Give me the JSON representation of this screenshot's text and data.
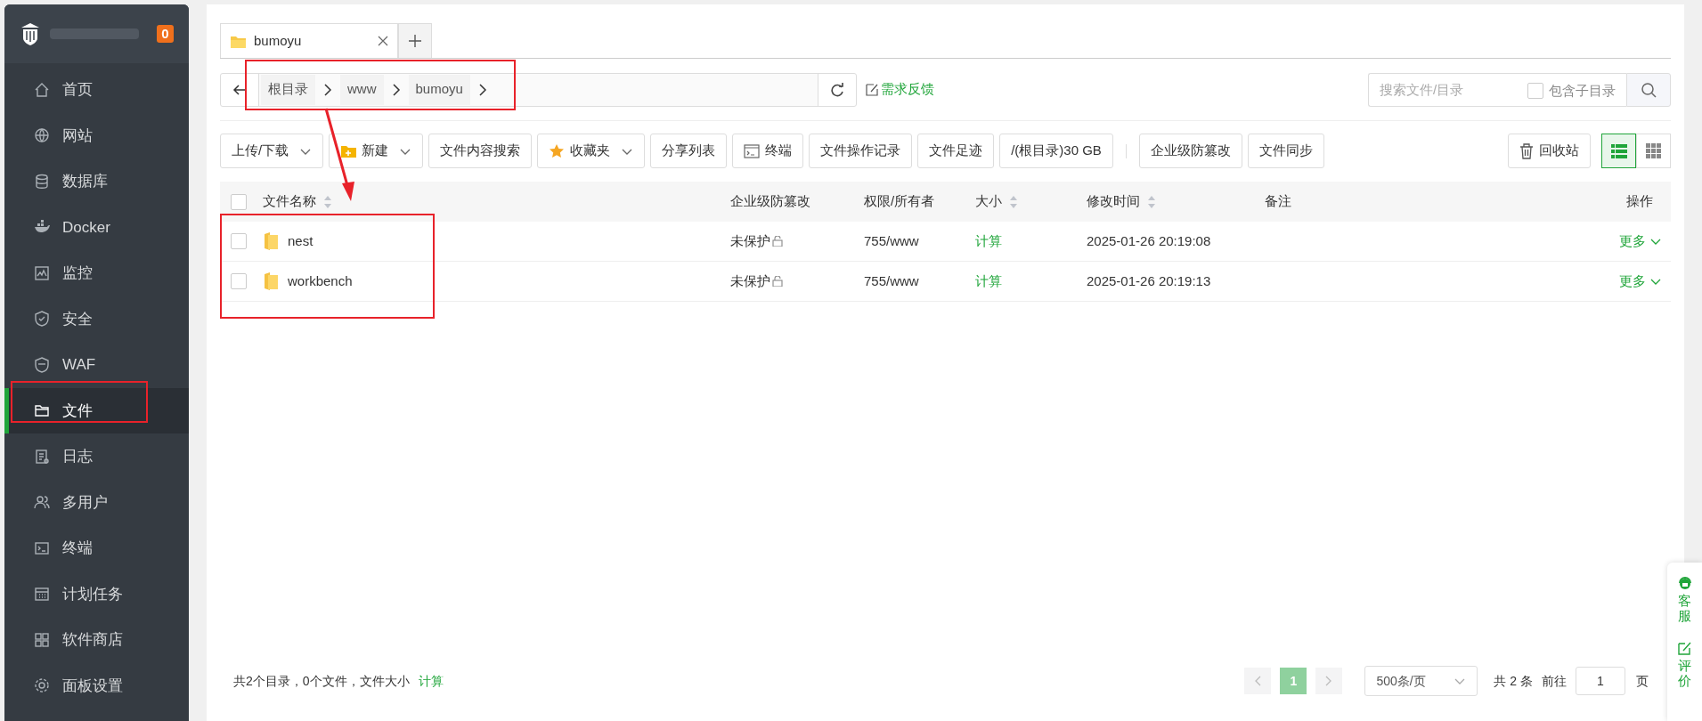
{
  "sidebar": {
    "badge": "0",
    "items": [
      {
        "label": "首页",
        "selected": false
      },
      {
        "label": "网站",
        "selected": false
      },
      {
        "label": "数据库",
        "selected": false
      },
      {
        "label": "Docker",
        "selected": false
      },
      {
        "label": "监控",
        "selected": false
      },
      {
        "label": "安全",
        "selected": false
      },
      {
        "label": "WAF",
        "selected": false
      },
      {
        "label": "文件",
        "selected": true
      },
      {
        "label": "日志",
        "selected": false
      },
      {
        "label": "多用户",
        "selected": false
      },
      {
        "label": "终端",
        "selected": false
      },
      {
        "label": "计划任务",
        "selected": false
      },
      {
        "label": "软件商店",
        "selected": false
      },
      {
        "label": "面板设置",
        "selected": false
      }
    ]
  },
  "tabs": [
    {
      "label": "bumoyu",
      "selected": true
    }
  ],
  "path_bar": {
    "crumbs": [
      "根目录",
      "www",
      "bumoyu"
    ],
    "feedback_link": "需求反馈"
  },
  "search": {
    "placeholder": "搜索文件/目录",
    "include_subdirs": {
      "label": "包含子目录",
      "checked": false
    }
  },
  "toolbar": {
    "groups": [
      [
        {
          "label": "上传/下载",
          "dropdown": true
        },
        {
          "label": "新建",
          "dropdown": true
        },
        {
          "label": "文件内容搜索",
          "dropdown": false
        },
        {
          "label": "收藏夹",
          "dropdown": true
        },
        {
          "label": "分享列表",
          "dropdown": false
        },
        {
          "label": "终端",
          "dropdown": false
        },
        {
          "label": "文件操作记录",
          "dropdown": false
        },
        {
          "label": "文件足迹",
          "dropdown": false
        },
        {
          "label": "/(根目录)30 GB",
          "dropdown": false
        }
      ],
      [
        {
          "label": "企业级防篡改",
          "dropdown": false
        },
        {
          "label": "文件同步",
          "dropdown": false
        }
      ]
    ],
    "recycle": "回收站",
    "view_modes": [
      {
        "kind": "list",
        "selected": true
      },
      {
        "kind": "grid",
        "selected": false
      }
    ]
  },
  "table": {
    "select_all": {
      "checked": false
    },
    "columns": [
      {
        "label": "文件名称",
        "sortable": true
      },
      {
        "label": "企业级防篡改",
        "sortable": false
      },
      {
        "label": "权限/所有者",
        "sortable": false
      },
      {
        "label": "大小",
        "sortable": true
      },
      {
        "label": "修改时间",
        "sortable": true
      },
      {
        "label": "备注",
        "sortable": false
      },
      {
        "label": "操作",
        "sortable": false
      }
    ],
    "rows": [
      {
        "checked": false,
        "name": "nest",
        "protect": "未保护",
        "perm": "755/www",
        "size": "计算",
        "mtime": "2025-01-26 20:19:08",
        "action": "更多"
      },
      {
        "checked": false,
        "name": "workbench",
        "protect": "未保护",
        "perm": "755/www",
        "size": "计算",
        "mtime": "2025-01-26 20:19:13",
        "action": "更多"
      }
    ]
  },
  "footer": {
    "summary": "共2个目录，0个文件，文件大小",
    "calc_link": "计算",
    "pages": [
      {
        "label": "1",
        "selected": true
      }
    ],
    "page_size": "500条/页",
    "total": "共 2 条",
    "goto_label": "前往",
    "goto_value": "1",
    "page_suffix": "页"
  },
  "float_widget": [
    {
      "label": "客服"
    },
    {
      "label": "评价"
    }
  ]
}
